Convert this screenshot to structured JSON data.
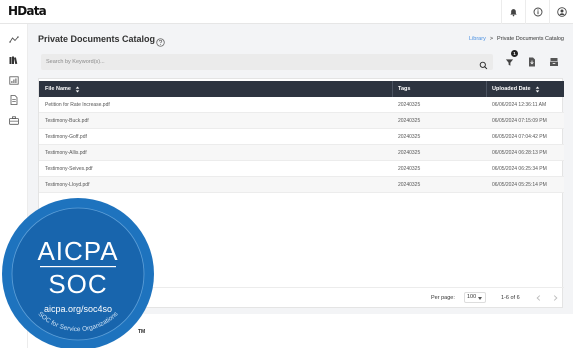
{
  "app": {
    "logo": "HData"
  },
  "header": {
    "icons": [
      "bell-icon",
      "info-icon",
      "user-icon"
    ]
  },
  "sidebar": {
    "icons": [
      "routes-icon",
      "library-icon",
      "chart-icon",
      "document-icon",
      "briefcase-icon"
    ]
  },
  "page": {
    "title": "Private Documents Catalog",
    "breadcrumb": {
      "parent": "Library",
      "separator": ">",
      "current": "Private Documents Catalog"
    }
  },
  "search": {
    "placeholder": "Search by Keyword(s)...",
    "value": "",
    "filter_badge": "1"
  },
  "table": {
    "columns": [
      "File Name",
      "Tags",
      "Uploaded Date"
    ],
    "rows": [
      {
        "file": "Petition for Rate Increase.pdf",
        "tags": "20240325",
        "date": "06/06/2024 12:36:11 AM"
      },
      {
        "file": "Testimony-Buck.pdf",
        "tags": "20240325",
        "date": "06/05/2024 07:15:09 PM"
      },
      {
        "file": "Testimony-Goff.pdf",
        "tags": "20240325",
        "date": "06/05/2024 07:04:42 PM"
      },
      {
        "file": "Testimony-Allis.pdf",
        "tags": "20240325",
        "date": "06/05/2024 06:28:13 PM"
      },
      {
        "file": "Testimony-Seives.pdf",
        "tags": "20240325",
        "date": "06/05/2024 06:25:34 PM"
      },
      {
        "file": "Testimony-Lloyd.pdf",
        "tags": "20240325",
        "date": "06/05/2024 05:25:14 PM"
      }
    ]
  },
  "pagination": {
    "per_page_label": "Per page:",
    "per_page_value": "100",
    "range": "1-6 of 6"
  },
  "seal": {
    "brand": "AICPA",
    "product": "SOC",
    "url": "aicpa.org/soc4so",
    "arc_text": "SOC for Service Organizations",
    "tm": "TM"
  },
  "colors": {
    "table_header": "#2d3440",
    "link": "#4a90e2",
    "seal_blue": "#1e73be",
    "seal_dark": "#145a9c"
  }
}
